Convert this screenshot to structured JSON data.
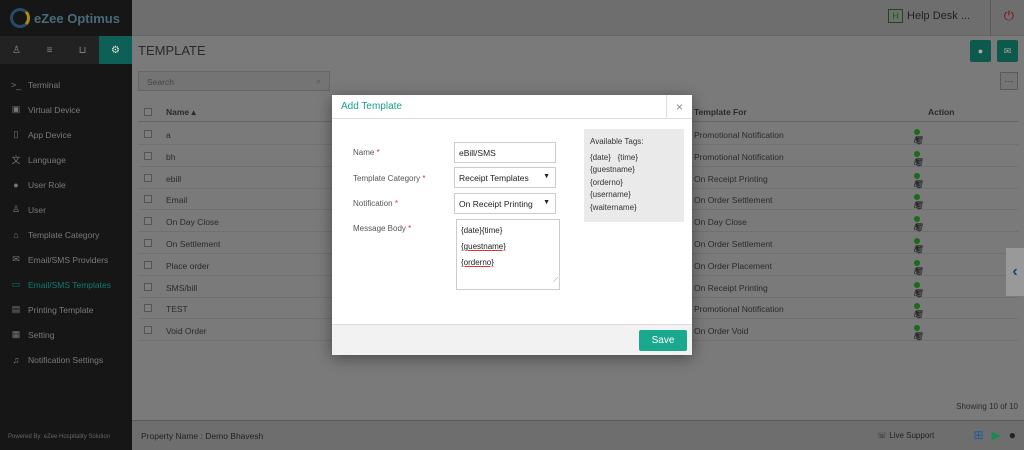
{
  "app": {
    "name": "eZee Optimus"
  },
  "header": {
    "help_desk": "Help Desk ...",
    "h_badge": "H"
  },
  "sidebar": {
    "items": [
      {
        "label": "Terminal",
        "icon": "terminal-icon",
        "glyph": ">_"
      },
      {
        "label": "Virtual Device",
        "icon": "virtual-device-icon",
        "glyph": "▣"
      },
      {
        "label": "App Device",
        "icon": "tablet-icon",
        "glyph": "▯"
      },
      {
        "label": "Language",
        "icon": "language-icon",
        "glyph": "文"
      },
      {
        "label": "User Role",
        "icon": "user-role-icon",
        "glyph": "●"
      },
      {
        "label": "User",
        "icon": "user-icon",
        "glyph": "♙"
      },
      {
        "label": "Template Category",
        "icon": "inbox-icon",
        "glyph": "⌂"
      },
      {
        "label": "Email/SMS Providers",
        "icon": "envelope-icon",
        "glyph": "✉"
      },
      {
        "label": "Email/SMS Templates",
        "icon": "template-icon",
        "glyph": "▭"
      },
      {
        "label": "Printing Template",
        "icon": "print-template-icon",
        "glyph": "▤"
      },
      {
        "label": "Setting",
        "icon": "setting-icon",
        "glyph": "▦"
      },
      {
        "label": "Notification Settings",
        "icon": "bell-icon",
        "glyph": "♫"
      }
    ],
    "powered_by": "Powered By: eZee Hospitality Solution"
  },
  "page": {
    "title": "TEMPLATE"
  },
  "search": {
    "placeholder": "Search"
  },
  "table": {
    "columns": {
      "name": "Name",
      "template_for": "Template For",
      "action": "Action"
    },
    "rows": [
      {
        "name": "a",
        "template_for": "Promotional Notification"
      },
      {
        "name": "bh",
        "template_for": "Promotional Notification"
      },
      {
        "name": "ebill",
        "template_for": "On Receipt Printing"
      },
      {
        "name": "Email",
        "template_for": "On Order Settlement"
      },
      {
        "name": "On Day Close",
        "template_for": "On Day Close"
      },
      {
        "name": "On Settlement",
        "template_for": "On Order Settlement"
      },
      {
        "name": "Place order",
        "template_for": "On Order Placement"
      },
      {
        "name": "SMS/bill",
        "template_for": "On Receipt Printing"
      },
      {
        "name": "TEST",
        "template_for": "Promotional Notification"
      },
      {
        "name": "Void Order",
        "template_for": "On Order Void"
      }
    ],
    "showing": "Showing 10 of 10"
  },
  "footer": {
    "property": "Property Name : Demo Bhavesh",
    "live_support": "Live Support"
  },
  "modal": {
    "title": "Add Template",
    "name_label": "Name",
    "name_value": "eBill/SMS",
    "category_label": "Template Category",
    "category_value": "Receipt Templates",
    "notification_label": "Notification",
    "notification_value": "On Receipt Printing",
    "body_label": "Message Body",
    "body_lines": [
      "{date}{time}",
      "{guestname}",
      "{orderno}"
    ],
    "tags_title": "Available Tags:",
    "tags": [
      "{date}   {time}",
      "{guestname}",
      "{orderno}",
      "{username}",
      "{waitername}"
    ],
    "required_mark": "*",
    "save_label": "Save"
  }
}
